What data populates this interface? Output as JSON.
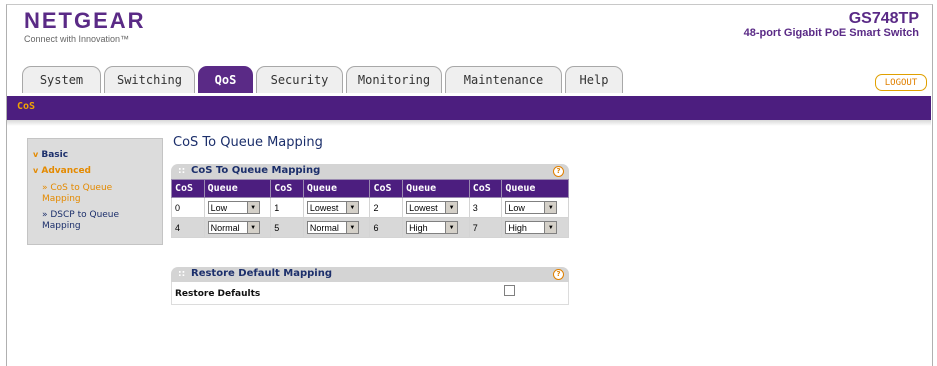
{
  "header": {
    "brand": "NETGEAR",
    "tagline": "Connect with Innovation™",
    "model": "GS748TP",
    "description": "48-port Gigabit PoE Smart Switch"
  },
  "tabs": [
    {
      "label": "System",
      "active": false
    },
    {
      "label": "Switching",
      "active": false
    },
    {
      "label": "QoS",
      "active": true
    },
    {
      "label": "Security",
      "active": false
    },
    {
      "label": "Monitoring",
      "active": false
    },
    {
      "label": "Maintenance",
      "active": false
    },
    {
      "label": "Help",
      "active": false
    }
  ],
  "logout_label": "LOGOUT",
  "subnav": {
    "active": "CoS"
  },
  "sidebar": {
    "basic": "Basic",
    "advanced": "Advanced",
    "items": [
      {
        "label": "» CoS to Queue Mapping",
        "active": true
      },
      {
        "label": "» DSCP to Queue Mapping",
        "active": false
      }
    ]
  },
  "page_title": "CoS To Queue Mapping",
  "cos_panel": {
    "title": "CoS To Queue Mapping",
    "headers": [
      "CoS",
      "Queue",
      "CoS",
      "Queue",
      "CoS",
      "Queue",
      "CoS",
      "Queue"
    ],
    "rows": [
      [
        {
          "cos": "0",
          "queue": "Low"
        },
        {
          "cos": "1",
          "queue": "Lowest"
        },
        {
          "cos": "2",
          "queue": "Lowest"
        },
        {
          "cos": "3",
          "queue": "Low"
        }
      ],
      [
        {
          "cos": "4",
          "queue": "Normal"
        },
        {
          "cos": "5",
          "queue": "Normal"
        },
        {
          "cos": "6",
          "queue": "High"
        },
        {
          "cos": "7",
          "queue": "High"
        }
      ]
    ]
  },
  "restore_panel": {
    "title": "Restore Default Mapping",
    "row_label": "Restore Defaults",
    "checked": false
  },
  "colors": {
    "brand_purple": "#4c1e7f",
    "accent_orange": "#e48a00",
    "link_blue": "#1c2f6b"
  },
  "icons": {
    "help": "help-icon",
    "dropdown": "chevron-down-icon",
    "bullet": "chevron-down-icon"
  }
}
